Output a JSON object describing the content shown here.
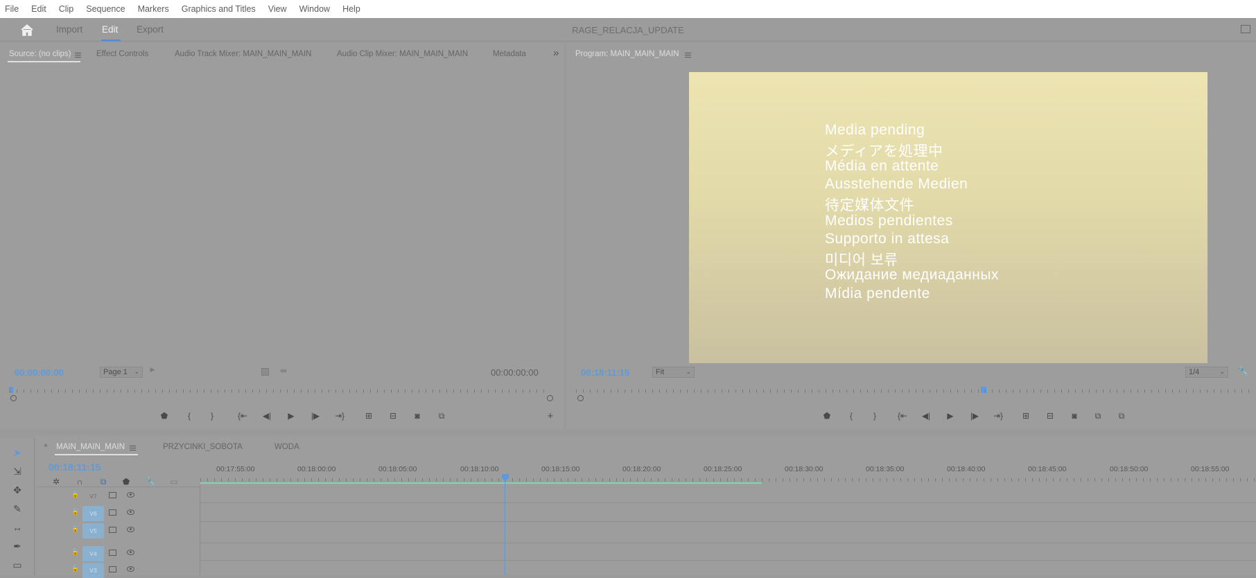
{
  "menu": [
    "File",
    "Edit",
    "Clip",
    "Sequence",
    "Markers",
    "Graphics and Titles",
    "View",
    "Window",
    "Help"
  ],
  "workspace": {
    "import": "Import",
    "edit": "Edit",
    "export": "Export",
    "project_title": "RAGE_RELACJA_UPDATE"
  },
  "source_panel": {
    "tabs": [
      "Source: (no clips)",
      "Effect Controls",
      "Audio Track Mixer: MAIN_MAIN_MAIN",
      "Audio Clip Mixer: MAIN_MAIN_MAIN",
      "Metadata"
    ],
    "overflow": "»",
    "timecode_in": "00:00:00:00",
    "page_select": "Page 1",
    "timecode_out": "00:00:00:00"
  },
  "program_panel": {
    "title": "Program: MAIN_MAIN_MAIN",
    "timecode": "00:18:11:15",
    "fit_select": "Fit",
    "resolution_select": "1/4",
    "media_pending": [
      "Media pending",
      "メディアを処理中",
      "Média en attente",
      "Ausstehende Medien",
      "待定媒体文件",
      "Medios pendientes",
      "Supporto in attesa",
      "미디어 보류",
      "Ожидание медиаданных",
      "Mídia pendente"
    ]
  },
  "timeline": {
    "tabs": [
      "MAIN_MAIN_MAIN",
      "PRZYCINKI_SOBOTA",
      "WODA"
    ],
    "timecode": "00:18:11:15",
    "ruler_labels": [
      "00:17:55:00",
      "00:18:00:00",
      "00:18:05:00",
      "00:18:10:00",
      "00:18:15:00",
      "00:18:20:00",
      "00:18:25:00",
      "00:18:30:00",
      "00:18:35:00",
      "00:18:40:00",
      "00:18:45:00",
      "00:18:50:00",
      "00:18:55:00"
    ],
    "tracks": [
      "V7",
      "V6",
      "V5",
      "V4",
      "V3"
    ]
  },
  "colors": {
    "accent": "#5b9bdd",
    "work_area": "#7fd6b0"
  }
}
